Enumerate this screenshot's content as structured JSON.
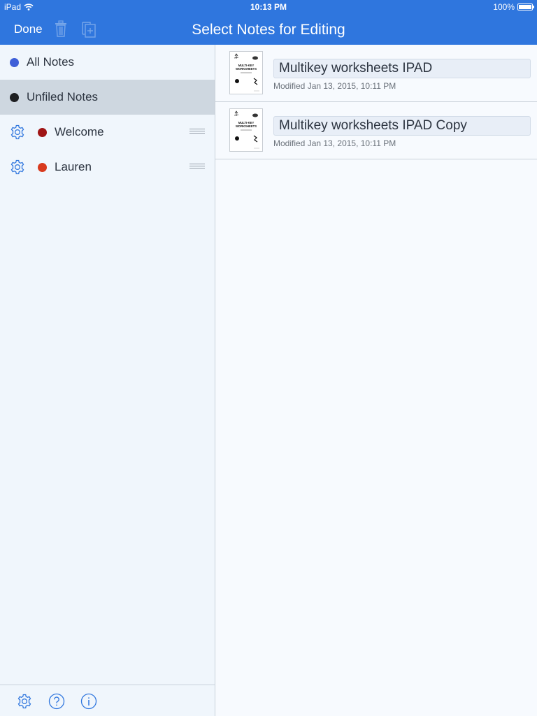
{
  "status": {
    "device": "iPad",
    "time": "10:13 PM",
    "battery": "100%"
  },
  "navbar": {
    "done_label": "Done",
    "title": "Select Notes for Editing"
  },
  "sidebar": {
    "items": [
      {
        "label": "All Notes",
        "color": "#3e5fd8"
      },
      {
        "label": "Unfiled Notes",
        "color": "#1e1f21"
      },
      {
        "label": "Welcome",
        "color": "#a01515"
      },
      {
        "label": "Lauren",
        "color": "#d83a1e"
      }
    ]
  },
  "notes": [
    {
      "title": "Multikey worksheets IPAD",
      "modified": "Modified Jan 13, 2015, 10:11 PM"
    },
    {
      "title": "Multikey worksheets IPAD Copy",
      "modified": "Modified Jan 13, 2015, 10:11 PM"
    }
  ],
  "thumbnail": {
    "heading_line1": "MULTI-KEY",
    "heading_line2": "WORKSHEETS"
  },
  "colors": {
    "accent": "#2f76de",
    "icon": "#2f76de"
  }
}
